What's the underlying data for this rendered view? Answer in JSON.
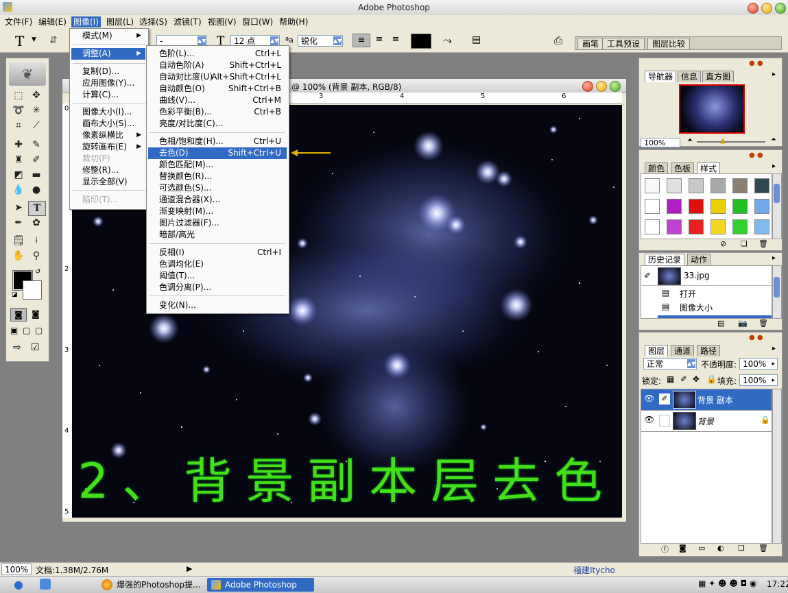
{
  "window": {
    "title": "Adobe Photoshop"
  },
  "menubar": [
    {
      "label": "文件(F)"
    },
    {
      "label": "编辑(E)"
    },
    {
      "label": "图像(I)"
    },
    {
      "label": "图层(L)"
    },
    {
      "label": "选择(S)"
    },
    {
      "label": "滤镜(T)"
    },
    {
      "label": "视图(V)"
    },
    {
      "label": "窗口(W)"
    },
    {
      "label": "帮助(H)"
    }
  ],
  "options": {
    "tool_glyph": "T",
    "font_style": "-",
    "font_size": "12 点",
    "antialias": "锐化",
    "panel_tabs": [
      "画笔",
      "工具预设",
      "图层比较"
    ]
  },
  "image_menu": {
    "items": [
      {
        "label": "模式(M)",
        "sub": true
      },
      {
        "label": "调整(A)",
        "sub": true,
        "active": true
      },
      {
        "label": "复制(D)..."
      },
      {
        "label": "应用图像(Y)..."
      },
      {
        "label": "计算(C)..."
      },
      {
        "label": "图像大小(I)..."
      },
      {
        "label": "画布大小(S)..."
      },
      {
        "label": "像素纵横比",
        "sub": true
      },
      {
        "label": "旋转画布(E)",
        "sub": true
      },
      {
        "label": "裁切(P)",
        "disabled": true
      },
      {
        "label": "修整(R)..."
      },
      {
        "label": "显示全部(V)"
      },
      {
        "label": "陷印(T)...",
        "disabled": true
      }
    ]
  },
  "adjust_menu": {
    "items": [
      {
        "label": "色阶(L)...",
        "shortcut": "Ctrl+L"
      },
      {
        "label": "自动色阶(A)",
        "shortcut": "Shift+Ctrl+L"
      },
      {
        "label": "自动对比度(U)",
        "shortcut": "Alt+Shift+Ctrl+L"
      },
      {
        "label": "自动颜色(O)",
        "shortcut": "Shift+Ctrl+B"
      },
      {
        "label": "曲线(V)...",
        "shortcut": "Ctrl+M"
      },
      {
        "label": "色彩平衡(B)...",
        "shortcut": "Ctrl+B"
      },
      {
        "label": "亮度/对比度(C)...",
        "shortcut": ""
      },
      {
        "label": "色相/饱和度(H)...",
        "shortcut": "Ctrl+U"
      },
      {
        "label": "去色(D)",
        "shortcut": "Shift+Ctrl+U",
        "highlight": true
      },
      {
        "label": "颜色匹配(M)...",
        "shortcut": ""
      },
      {
        "label": "替换颜色(R)...",
        "shortcut": ""
      },
      {
        "label": "可选颜色(S)...",
        "shortcut": ""
      },
      {
        "label": "通道混合器(X)...",
        "shortcut": ""
      },
      {
        "label": "渐变映射(M)...",
        "shortcut": ""
      },
      {
        "label": "图片过滤器(F)...",
        "shortcut": ""
      },
      {
        "label": "暗部/高光",
        "shortcut": ""
      },
      {
        "label": "反相(I)",
        "shortcut": "Ctrl+I"
      },
      {
        "label": "色调均化(E)",
        "shortcut": ""
      },
      {
        "label": "阈值(T)...",
        "shortcut": ""
      },
      {
        "label": "色调分离(P)...",
        "shortcut": ""
      },
      {
        "label": "变化(N)...",
        "shortcut": ""
      }
    ]
  },
  "document": {
    "title": "@ 100% (背景 副本, RGB/8)",
    "ruler_top": [
      "3",
      "4",
      "5",
      "6"
    ],
    "ruler_left": [
      "1",
      "2",
      "3",
      "4",
      "5"
    ],
    "ruler_origin": "0",
    "caption": "2、背景副本层去色"
  },
  "navigator": {
    "tabs": [
      "导航器",
      "信息",
      "直方图"
    ],
    "zoom": "100%"
  },
  "color_panel": {
    "tabs": [
      "颜色",
      "色板",
      "样式"
    ]
  },
  "history": {
    "tabs": [
      "历史记录",
      "动作"
    ],
    "snapshot": "33.jpg",
    "steps": [
      "打开",
      "图像大小"
    ]
  },
  "layers": {
    "tabs": [
      "图层",
      "通道",
      "路径"
    ],
    "blend_mode": "正常",
    "opacity_label": "不透明度:",
    "opacity": "100%",
    "lock_label": "锁定:",
    "fill_label": "填充:",
    "fill": "100%",
    "items": [
      {
        "name": "背景 副本",
        "selected": true
      },
      {
        "name": "背景",
        "selected": false
      }
    ]
  },
  "status": {
    "zoom": "100%",
    "doc": "文档:1.38M/2.76M",
    "ime": "福建Itycho"
  },
  "taskbar": {
    "items": [
      "爆强的Photoshop提...",
      "Adobe Photoshop"
    ],
    "clock": "17:22"
  },
  "colors": {
    "accent": "#316ac5",
    "caption": "#44e015"
  }
}
